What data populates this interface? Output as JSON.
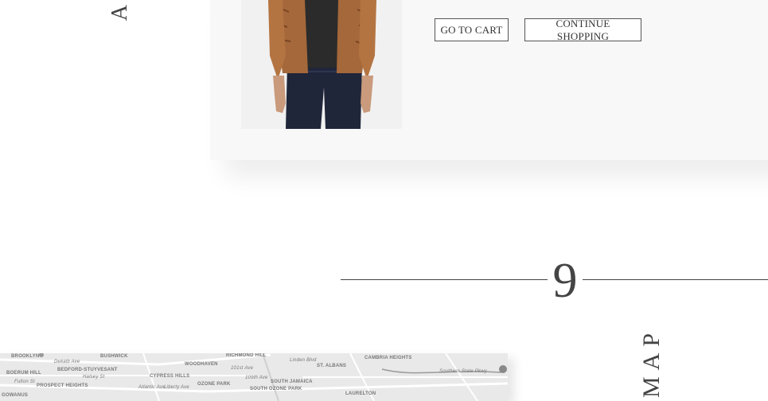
{
  "side_heading_top": "A",
  "cart_actions": {
    "go_to_cart_label": "GO TO CART",
    "continue_shopping_label": "CONTINUE SHOPPING"
  },
  "section": {
    "number": "9",
    "vertical_title": "MAP"
  },
  "map": {
    "labels": {
      "brooklyn": "BROOKLYN",
      "bushwick": "BUSHWICK",
      "richmond_hill": "RICHMOND HILL",
      "cambria_heights": "CAMBRIA HEIGHTS",
      "boerum_hill": "BOERUM HILL",
      "bedford": "BEDFORD-STUYVESANT",
      "cypress_hills": "CYPRESS HILLS",
      "woodhaven": "WOODHAVEN",
      "st_albans": "ST. ALBANS",
      "prospect_heights": "PROSPECT HEIGHTS",
      "ozone_park": "OZONE PARK",
      "south_jamaica": "SOUTH JAMAICA",
      "south_ozone_park": "SOUTH OZONE PARK",
      "laurelton": "LAURELTON",
      "gowanus": "GOWANUS",
      "dekalb_ave": "Dekalb Ave",
      "halsey_st": "Halsey St",
      "fulton_st": "Fulton St",
      "atlantic_ave": "Atlantic Ave",
      "liberty_ave": "Liberty Ave",
      "linden_blvd": "Linden Blvd",
      "ave_101": "101st Ave",
      "ave_109": "109th Ave",
      "southern_state": "Southern State Pkwy"
    }
  }
}
